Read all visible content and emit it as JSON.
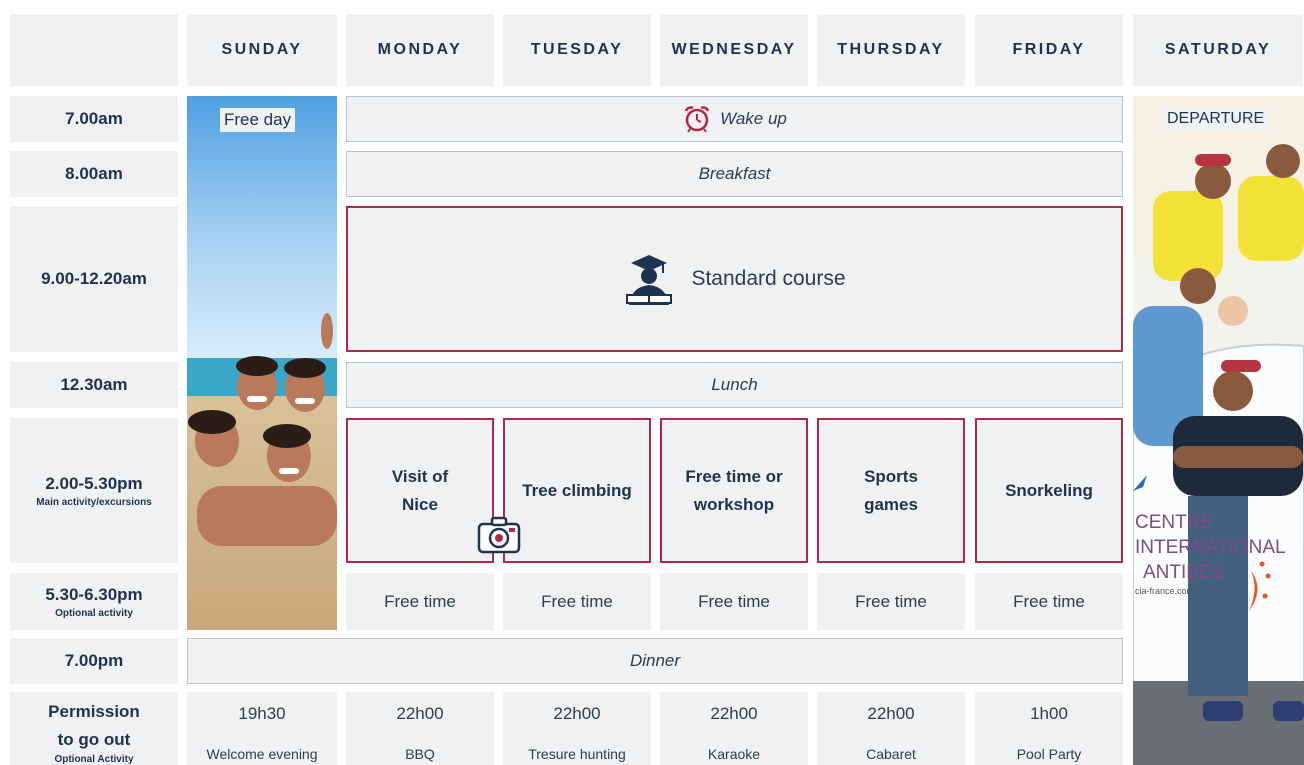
{
  "days": [
    "SUNDAY",
    "MONDAY",
    "TUESDAY",
    "WEDNESDAY",
    "THURSDAY",
    "FRIDAY",
    "SATURDAY"
  ],
  "times": [
    {
      "main": "7.00am",
      "sub": ""
    },
    {
      "main": "8.00am",
      "sub": ""
    },
    {
      "main": "9.00-12.20am",
      "sub": ""
    },
    {
      "main": "12.30am",
      "sub": ""
    },
    {
      "main": "2.00-5.30pm",
      "sub": "Main activity/excursions"
    },
    {
      "main": "5.30-6.30pm",
      "sub": "Optional activity"
    },
    {
      "main": "7.00pm",
      "sub": ""
    },
    {
      "main": "Permission to go out",
      "sub": "Optional Activity"
    }
  ],
  "sunday_label": "Free day",
  "saturday_label": "DEPARTURE",
  "bands": {
    "wake_up": "Wake up",
    "breakfast": "Breakfast",
    "course": "Standard course",
    "lunch": "Lunch",
    "dinner": "Dinner"
  },
  "activities": [
    "Visit of Nice",
    "Tree climbing",
    "Free time or workshop",
    "Sports games",
    "Snorkeling"
  ],
  "free_time": [
    "Free time",
    "Free time",
    "Free time",
    "Free time",
    "Free time"
  ],
  "permission": [
    {
      "time": "19h30",
      "event": "Welcome evening"
    },
    {
      "time": "22h00",
      "event": "BBQ"
    },
    {
      "time": "22h00",
      "event": "Tresure hunting"
    },
    {
      "time": "22h00",
      "event": "Karaoke"
    },
    {
      "time": "22h00",
      "event": "Cabaret"
    },
    {
      "time": "1h00",
      "event": "Pool Party"
    }
  ],
  "car_text": {
    "line1": "CENTRE",
    "line2": "INTERNATIONAL",
    "line3": "ANTIBES",
    "url": "cia-france.com"
  },
  "icons": [
    "alarm-clock-icon",
    "graduate-icon",
    "camera-icon"
  ],
  "colors": {
    "cell": "#f0f1f3",
    "text": "#1f3350",
    "accent_red": "#b3284a",
    "band_border": "#b8c3cf"
  }
}
